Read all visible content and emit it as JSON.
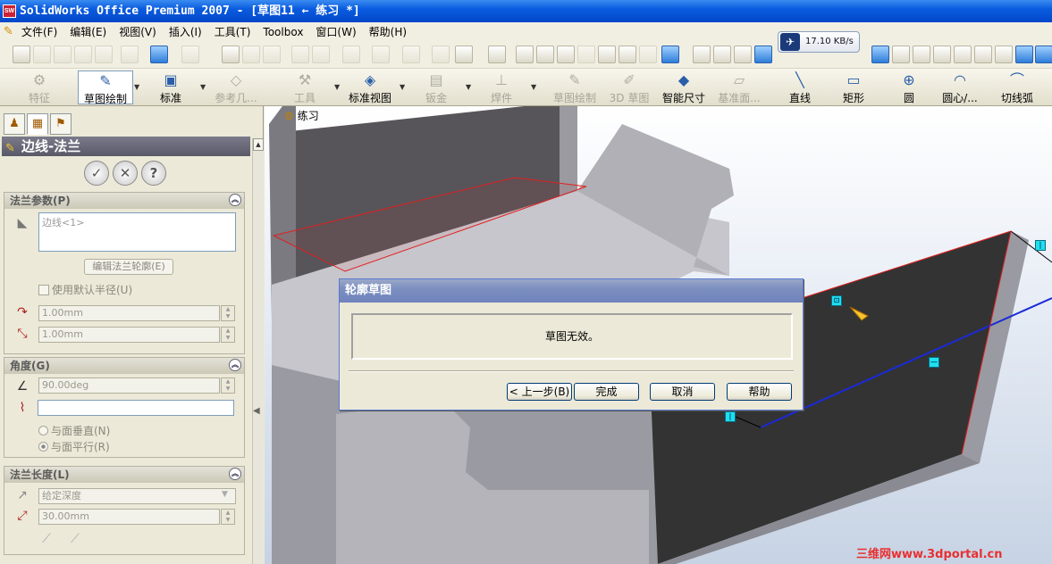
{
  "window": {
    "title": "SolidWorks Office Premium 2007 - [草图11 ← 练习 *]",
    "logo": "SW"
  },
  "menu": [
    "文件(F)",
    "编辑(E)",
    "视图(V)",
    "插入(I)",
    "工具(T)",
    "Toolbox",
    "窗口(W)",
    "帮助(H)"
  ],
  "network": {
    "speed": "17.10 KB/s"
  },
  "command_manager": {
    "items": [
      {
        "label": "特征",
        "icon": "feature-icon"
      },
      {
        "label": "草图绘制",
        "icon": "sketch-icon"
      },
      {
        "label": "标准",
        "icon": "standard-icon"
      },
      {
        "label": "参考几...",
        "icon": "reference-geometry-icon"
      },
      {
        "label": "工具",
        "icon": "tools-icon"
      },
      {
        "label": "标准视图",
        "icon": "standard-views-icon"
      },
      {
        "label": "钣金",
        "icon": "sheet-metal-icon"
      },
      {
        "label": "焊件",
        "icon": "weldments-icon"
      },
      {
        "label": "草图绘制",
        "icon": "sketch-icon"
      },
      {
        "label": "3D 草图",
        "icon": "3d-sketch-icon"
      },
      {
        "label": "智能尺寸",
        "icon": "smart-dimension-icon"
      },
      {
        "label": "基准面...",
        "icon": "plane-icon"
      },
      {
        "label": "直线",
        "icon": "line-icon"
      },
      {
        "label": "矩形",
        "icon": "rectangle-icon"
      },
      {
        "label": "圆",
        "icon": "circle-icon"
      },
      {
        "label": "圆心/...",
        "icon": "centerpoint-arc-icon"
      },
      {
        "label": "切线弧",
        "icon": "tangent-arc-icon"
      }
    ]
  },
  "property_manager": {
    "title": "边线-法兰",
    "flange_params": {
      "header": "法兰参数(P)",
      "edge_list": "边线<1>",
      "edit_profile": "编辑法兰轮廓(E)",
      "use_default_radius": "使用默认半径(U)",
      "radius": "1.00mm",
      "gap": "1.00mm"
    },
    "angle": {
      "header": "角度(G)",
      "value": "90.00deg",
      "perpendicular": "与面垂直(N)",
      "parallel": "与面平行(R)"
    },
    "flange_length": {
      "header": "法兰长度(L)",
      "end_condition": "给定深度",
      "length": "30.00mm"
    }
  },
  "viewport": {
    "part_label": "练习"
  },
  "dialog": {
    "title": "轮廓草图",
    "message": "草图无效。",
    "buttons": {
      "back": "< 上一步(B)",
      "finish": "完成",
      "cancel": "取消",
      "help": "帮助"
    }
  },
  "watermark": "三维网www.3dportal.cn"
}
